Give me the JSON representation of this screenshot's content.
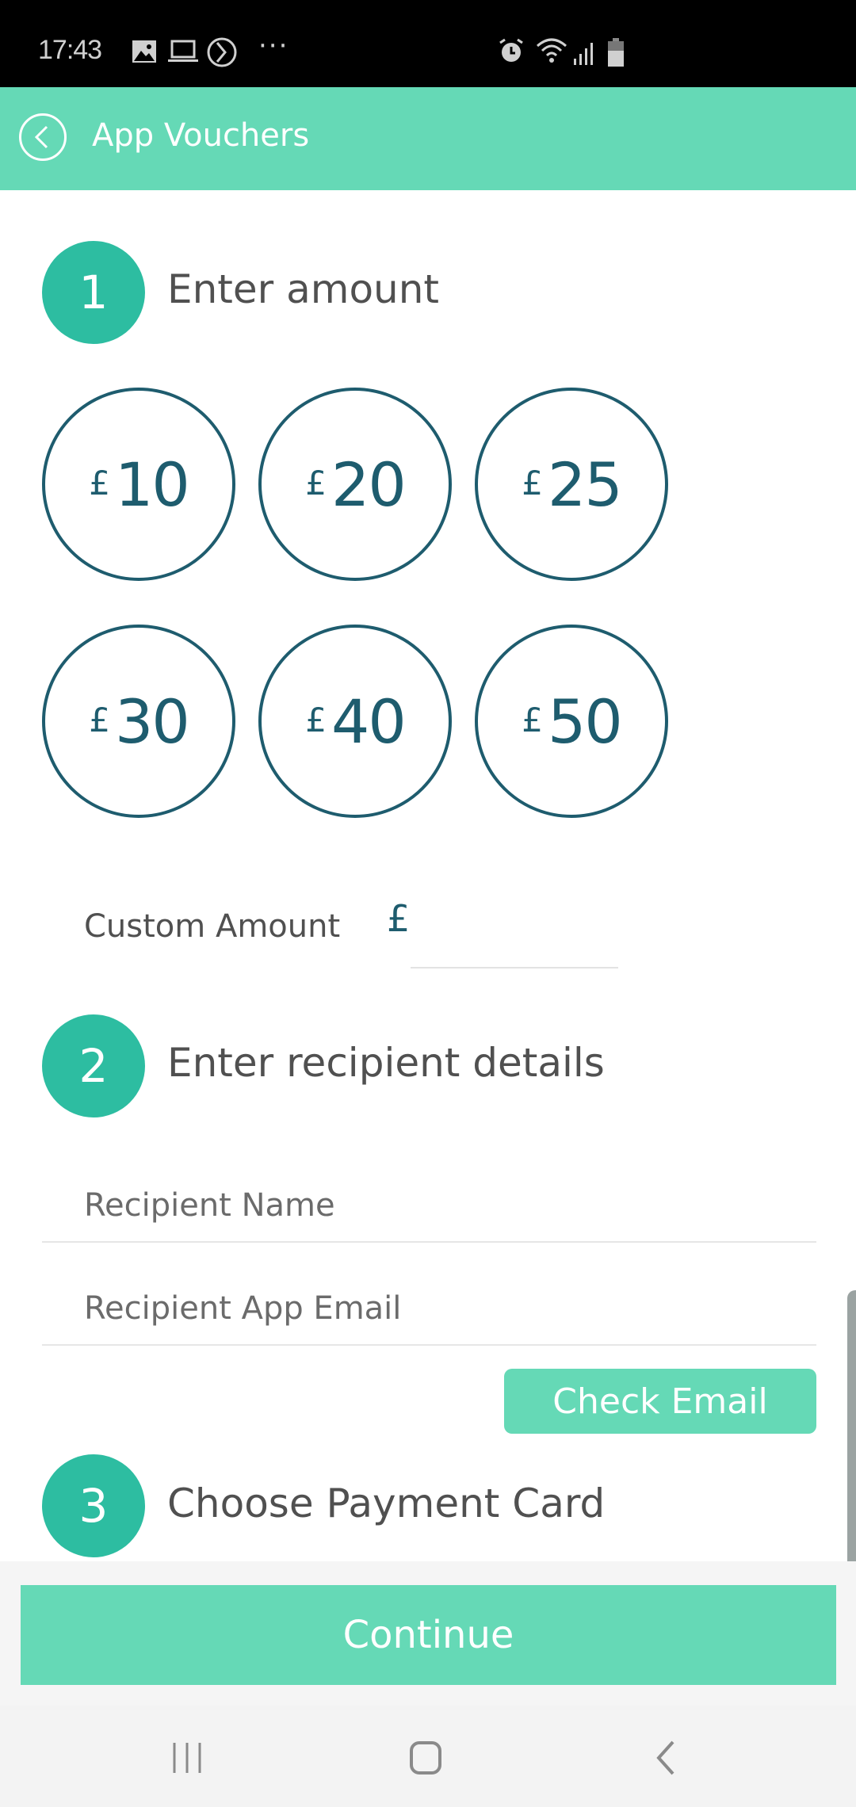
{
  "status_bar": {
    "time": "17:43",
    "left_icons": [
      "image-icon",
      "laptop-icon",
      "media-icon",
      "more-dots-icon"
    ],
    "more": "···",
    "right_icons": [
      "alarm-icon",
      "wifi-icon",
      "signal-icon",
      "battery-icon"
    ]
  },
  "app_bar": {
    "title": "App Vouchers",
    "back_icon": "back-circle-icon"
  },
  "step1": {
    "number": "1",
    "title": "Enter amount",
    "amounts": [
      {
        "currency": "£",
        "value": "10"
      },
      {
        "currency": "£",
        "value": "20"
      },
      {
        "currency": "£",
        "value": "25"
      },
      {
        "currency": "£",
        "value": "30"
      },
      {
        "currency": "£",
        "value": "40"
      },
      {
        "currency": "£",
        "value": "50"
      }
    ],
    "custom_label": "Custom Amount",
    "custom_currency": "£",
    "custom_value": ""
  },
  "step2": {
    "number": "2",
    "title": "Enter recipient details",
    "name_placeholder": "Recipient Name",
    "name_value": "",
    "email_placeholder": "Recipient App Email",
    "email_value": "",
    "check_email_label": "Check Email"
  },
  "step3": {
    "number": "3",
    "title": "Choose Payment Card"
  },
  "footer": {
    "continue_label": "Continue"
  },
  "nav_bar": {
    "items": [
      "recent-apps-icon",
      "home-icon",
      "back-icon"
    ]
  },
  "colors": {
    "accent": "#65D9B6",
    "step_badge": "#2DBDA1",
    "amount_ring": "#1E5C6E",
    "heading_text": "#505050"
  }
}
